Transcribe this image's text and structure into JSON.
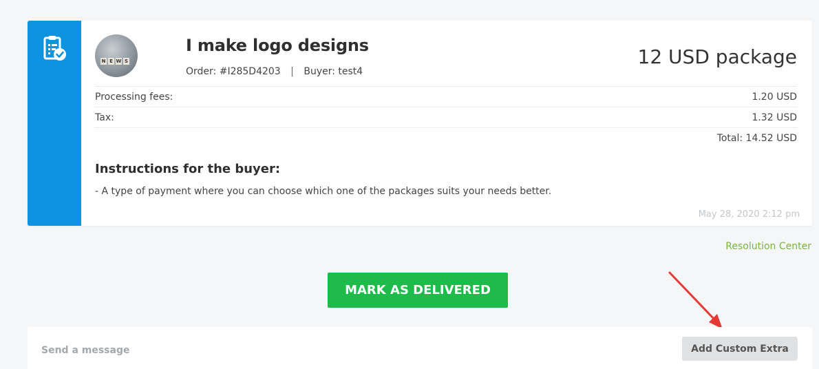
{
  "order": {
    "gig_title": "I make logo designs",
    "order_label": "Order:",
    "order_id": "#I285D4203",
    "separator": "|",
    "buyer_label": "Buyer:",
    "buyer_name": "test4",
    "package": "12 USD package",
    "avatar_letters": [
      "N",
      "E",
      "W",
      "S"
    ],
    "fees": [
      {
        "label": "Processing fees:",
        "amount": "1.20 USD"
      },
      {
        "label": "Tax:",
        "amount": "1.32 USD"
      }
    ],
    "total": "Total: 14.52 USD",
    "instructions_title": "Instructions for the buyer:",
    "instructions_text": "- A type of payment where you can choose which one of the packages suits your needs better.",
    "timestamp": "May 28, 2020 2:12 pm"
  },
  "links": {
    "resolution_center": "Resolution Center"
  },
  "actions": {
    "mark_delivered": "MARK AS DELIVERED"
  },
  "message": {
    "placeholder": "Send a message",
    "add_custom_extra": "Add Custom Extra"
  },
  "icons": {
    "strip_icon": "clipboard-check-icon",
    "annotation": "red-arrow-icon"
  },
  "colors": {
    "strip_blue": "#0e93e0",
    "deliver_green": "#1fbb4a",
    "link_green": "#7cb342",
    "arrow_red": "#e53935"
  }
}
